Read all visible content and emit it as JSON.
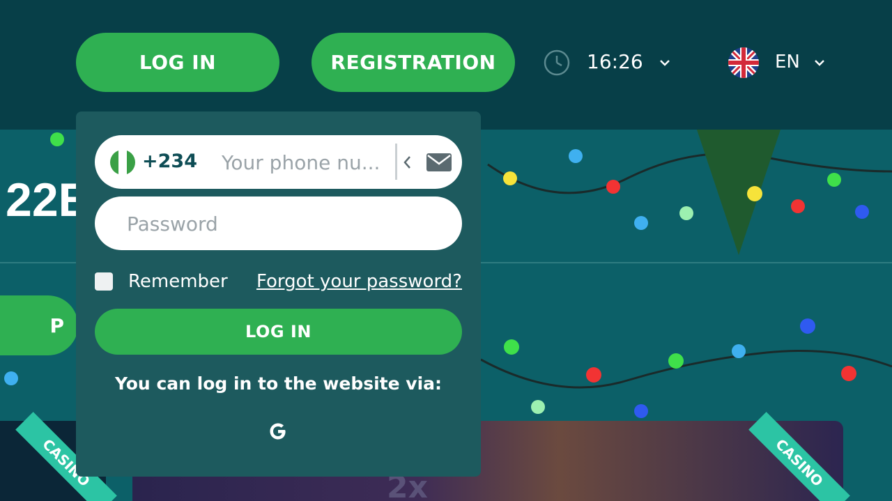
{
  "header": {
    "login_label": "LOG IN",
    "registration_label": "REGISTRATION",
    "time": "16:26",
    "language": "EN"
  },
  "background": {
    "promo_text": "22E",
    "left_button_text": "P",
    "ribbon_left": "CASINO",
    "ribbon_right": "CASINO",
    "card_text": "2x"
  },
  "login_popup": {
    "country_code": "+234",
    "phone_placeholder": "Your phone nu...",
    "password_placeholder": "Password",
    "remember_label": "Remember",
    "forgot_link": "Forgot your password?",
    "login_button": "LOG IN",
    "social_text": "You can log in to the website via:"
  },
  "icons": {
    "clock": "clock-icon",
    "chevron": "chevron-down-icon",
    "flag_uk": "uk-flag-icon",
    "flag_ng": "nigeria-flag-icon",
    "back": "chevron-left-icon",
    "mail": "envelope-icon",
    "google": "google-icon"
  },
  "colors": {
    "accent_green": "#2fb052",
    "header_bg": "#073f48",
    "popup_bg": "#1d5a5e",
    "ribbon": "#2cc4a4"
  }
}
